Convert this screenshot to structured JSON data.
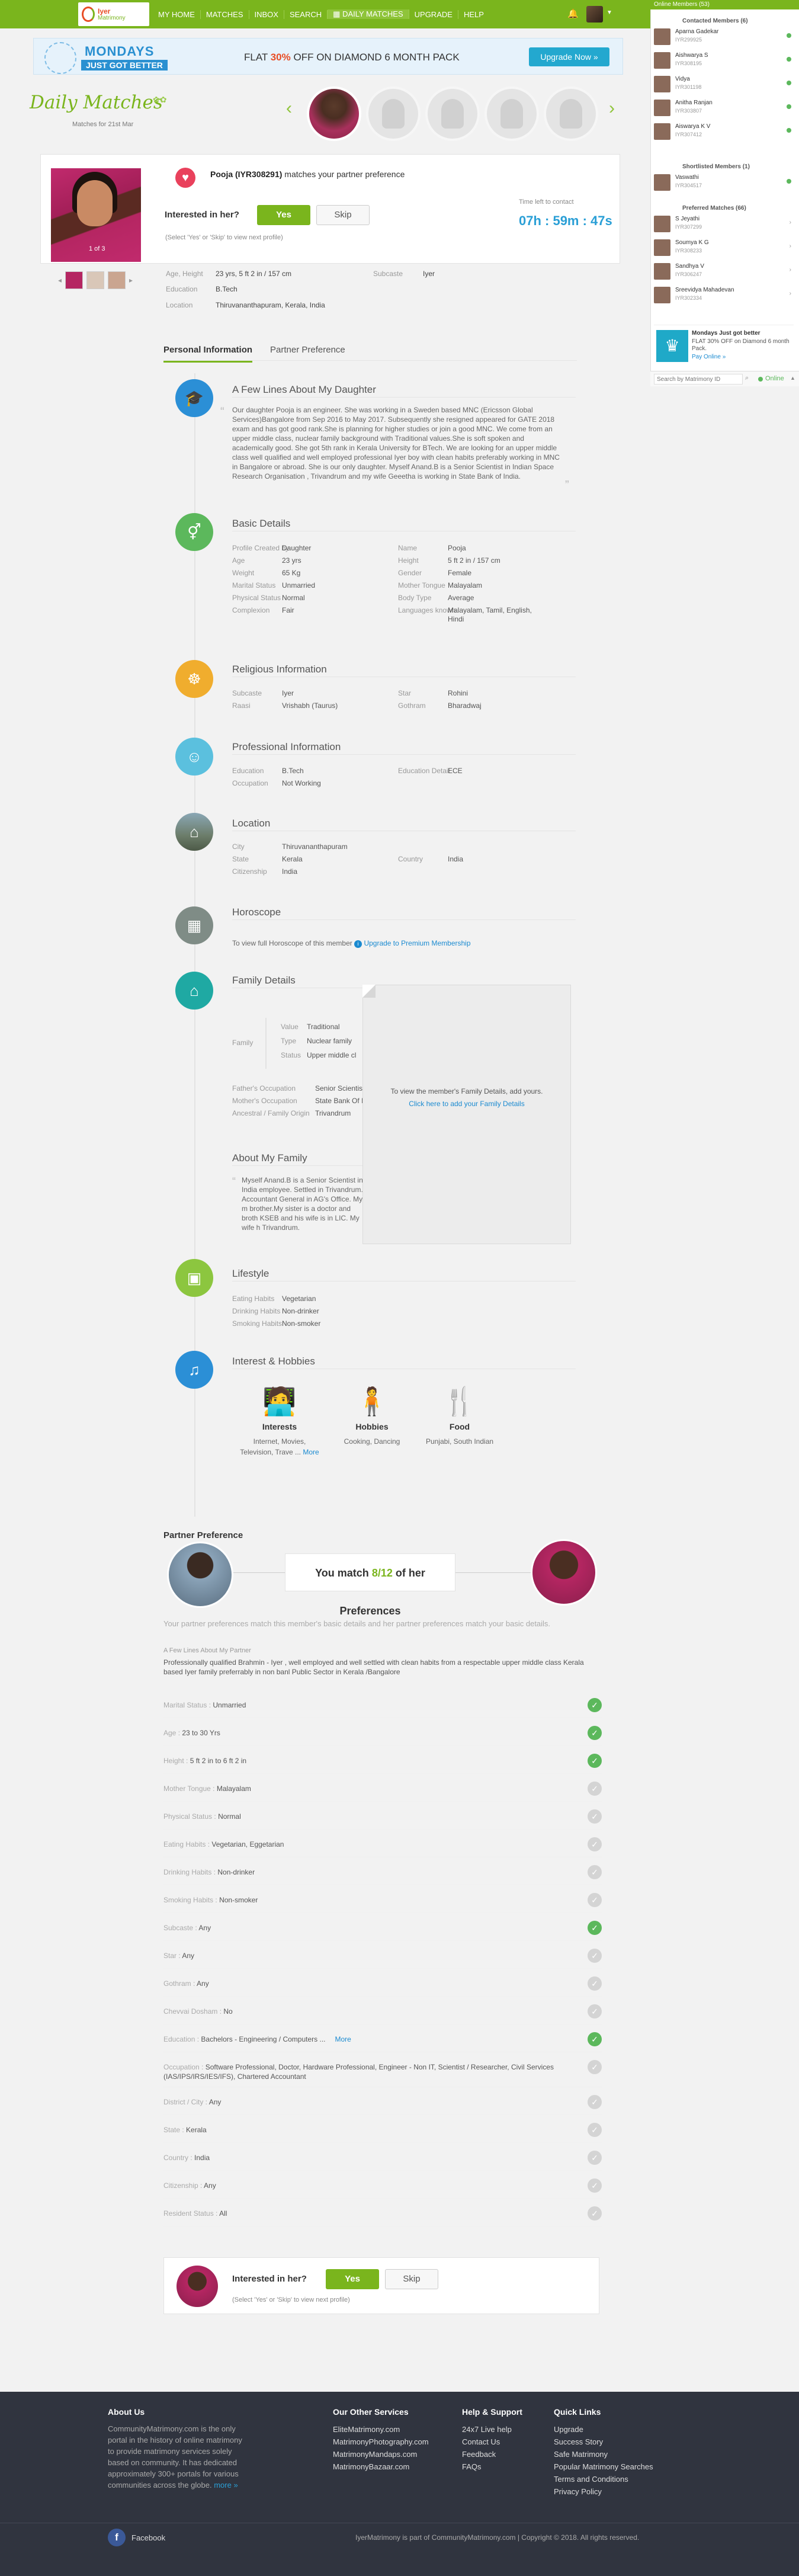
{
  "nav": {
    "logo_title": "Iyer",
    "logo_sub": "Matrimony",
    "items": [
      "MY HOME",
      "MATCHES",
      "INBOX",
      "SEARCH",
      "DAILY MATCHES",
      "UPGRADE",
      "HELP"
    ],
    "active_index": 4
  },
  "banner": {
    "line1": "MONDAYS",
    "line2": "JUST GOT BETTER",
    "offer_pre": "FLAT ",
    "offer_pct": "30%",
    "offer_post": " OFF ON DIAMOND 6 MONTH PACK",
    "button": "Upgrade Now »"
  },
  "daily": {
    "title": "Daily Matches",
    "subtitle": "Matches for 21st Mar"
  },
  "profile": {
    "id_name": "Pooja (IYR308291)",
    "id_suffix": " matches your partner preference",
    "photo_count": "1 of 3",
    "interested_q": "Interested in her?",
    "yes": "Yes",
    "skip": "Skip",
    "hint": "(Select 'Yes' or 'Skip' to view next profile)",
    "time_label": "Time left to contact",
    "time_value": "07h : 59m : 47s",
    "summary": [
      {
        "label": "Age, Height",
        "value": "23 yrs, 5 ft 2 in / 157 cm"
      },
      {
        "label": "Education",
        "value": "B.Tech"
      },
      {
        "label": "Location",
        "value": "Thiruvananthapuram, Kerala, India"
      }
    ],
    "subcaste_label": "Subcaste",
    "subcaste_value": "Iyer"
  },
  "tabs": [
    "Personal Information",
    "Partner Preference"
  ],
  "sections": {
    "about": {
      "title": "A Few Lines About My Daughter",
      "text": "Our daughter Pooja is an engineer. She was working in a Sweden based MNC (Ericsson Global Services)Bangalore from Sep 2016 to May 2017. Subsequently she resigned appeared for GATE 2018 exam and has got good rank.She is planning for higher studies or join a good MNC. We come from an upper middle class, nuclear family background with Traditional values.She is soft spoken and academically good. She got 5th rank in Kerala University for BTech. We are looking for an upper middle class well qualified and well employed professional Iyer boy with clean habits preferably working in MNC in Bangalore or abroad. She is our only daughter. Myself Anand.B is a Senior Scientist in Indian Space Research Organisation , Trivandrum and my wife Geeetha is working in State Bank of India."
    },
    "basic": {
      "title": "Basic Details",
      "left": [
        [
          "Profile Created by",
          "Daughter"
        ],
        [
          "Age",
          "23 yrs"
        ],
        [
          "Weight",
          "65 Kg"
        ],
        [
          "Marital Status",
          "Unmarried"
        ],
        [
          "Physical Status",
          "Normal"
        ],
        [
          "Complexion",
          "Fair"
        ]
      ],
      "right": [
        [
          "Name",
          "Pooja"
        ],
        [
          "Height",
          "5 ft 2 in / 157 cm"
        ],
        [
          "Gender",
          "Female"
        ],
        [
          "Mother Tongue",
          "Malayalam"
        ],
        [
          "Body Type",
          "Average"
        ],
        [
          "Languages known",
          "Malayalam, Tamil, English, Hindi"
        ]
      ]
    },
    "religious": {
      "title": "Religious Information",
      "left": [
        [
          "Subcaste",
          "Iyer"
        ],
        [
          "Raasi",
          "Vrishabh (Taurus)"
        ]
      ],
      "right": [
        [
          "Star",
          "Rohini"
        ],
        [
          "Gothram",
          "Bharadwaj"
        ]
      ]
    },
    "professional": {
      "title": "Professional Information",
      "left": [
        [
          "Education",
          "B.Tech"
        ],
        [
          "Occupation",
          "Not Working"
        ]
      ],
      "right": [
        [
          "Education Detail",
          "ECE"
        ]
      ]
    },
    "location": {
      "title": "Location",
      "left": [
        [
          "City",
          "Thiruvananthapuram"
        ],
        [
          "State",
          "Kerala"
        ],
        [
          "Citizenship",
          "India"
        ]
      ],
      "right": [
        [
          "Country",
          "India"
        ]
      ]
    },
    "horoscope": {
      "title": "Horoscope",
      "text": "To view full Horoscope of this member",
      "link": "Upgrade to Premium Membership"
    },
    "family": {
      "title": "Family Details",
      "family_label": "Family",
      "values": [
        [
          "Value",
          "Traditional"
        ],
        [
          "Type",
          "Nuclear family"
        ],
        [
          "Status",
          "Upper middle cl"
        ]
      ],
      "rows": [
        [
          "Father's Occupation",
          "Senior Scientist"
        ],
        [
          "Mother's Occupation",
          "State Bank Of I"
        ],
        [
          "Ancestral / Family Origin",
          "Trivandrum"
        ]
      ],
      "overlay_text": "To view the member's Family Details, add yours.",
      "overlay_link": "Click here to add your Family Details"
    },
    "about_family": {
      "title": "About My Family",
      "text": "Myself Anand.B is a Senior Scientist in India employee. Settled in Trivandrum. Accountant General in AG's Office. My m brother.My sister is a doctor and broth KSEB and his wife is in LIC. My wife h Trivandrum."
    },
    "lifestyle": {
      "title": "Lifestyle",
      "rows": [
        [
          "Eating Habits",
          "Vegetarian"
        ],
        [
          "Drinking Habits",
          "Non-drinker"
        ],
        [
          "Smoking Habits",
          "Non-smoker"
        ]
      ]
    },
    "interests": {
      "title": "Interest & Hobbies",
      "items": [
        {
          "title": "Interests",
          "text": "Internet, Movies, Television, Trave ...",
          "more": "More"
        },
        {
          "title": "Hobbies",
          "text": "Cooking, Dancing",
          "more": ""
        },
        {
          "title": "Food",
          "text": "Punjabi, South Indian",
          "more": ""
        }
      ]
    }
  },
  "partner": {
    "title": "Partner Preference",
    "match_pre": "You match ",
    "match_num": "8/12",
    "match_post": " of her Preferences",
    "note": "Your partner preferences match this member's basic details and her partner preferences match your basic details.",
    "few_lines_label": "A Few Lines About My Partner",
    "few_lines": "Professionally qualified Brahmin - Iyer , well employed and well settled with clean habits from a respectable upper middle class Kerala based Iyer family preferrably in non banl Public Sector in Kerala /Bangalore",
    "rows": [
      {
        "label": "Marital Status",
        "value": "Unmarried",
        "match": true
      },
      {
        "label": "Age",
        "value": "23 to 30 Yrs",
        "match": true
      },
      {
        "label": "Height",
        "value": "5 ft 2 in to 6 ft 2 in",
        "match": true
      },
      {
        "label": "Mother Tongue",
        "value": "Malayalam",
        "match": false
      },
      {
        "label": "Physical Status",
        "value": "Normal",
        "match": null
      },
      {
        "label": "Eating Habits",
        "value": "Vegetarian, Eggetarian",
        "match": false
      },
      {
        "label": "Drinking Habits",
        "value": "Non-drinker",
        "match": null
      },
      {
        "label": "Smoking Habits",
        "value": "Non-smoker",
        "match": null
      },
      {
        "label": "Subcaste",
        "value": "Any",
        "match": true
      },
      {
        "label": "Star",
        "value": "Any",
        "match": null
      },
      {
        "label": "Gothram",
        "value": "Any",
        "match": null
      },
      {
        "label": "Chevvai Dosham",
        "value": "No",
        "match": false
      },
      {
        "label": "Education",
        "value": "Bachelors - Engineering / Computers ...",
        "more": "More",
        "match": true
      },
      {
        "label": "Occupation",
        "value": "Software Professional, Doctor, Hardware Professional, Engineer - Non IT, Scientist / Researcher, Civil Services (IAS/IPS/IRS/IES/IFS), Chartered Accountant",
        "match": false
      },
      {
        "label": "District / City",
        "value": "Any",
        "match": false
      },
      {
        "label": "State",
        "value": "Kerala",
        "match": false
      },
      {
        "label": "Country",
        "value": "India",
        "match": false
      },
      {
        "label": "Citizenship",
        "value": "Any",
        "match": null
      },
      {
        "label": "Resident Status",
        "value": "All",
        "match": null
      }
    ]
  },
  "bottom": {
    "interested_q": "Interested in her?",
    "yes": "Yes",
    "skip": "Skip",
    "hint": "(Select 'Yes' or 'Skip' to view next profile)"
  },
  "footer": {
    "about_title": "About Us",
    "about_text": "CommunityMatrimony.com is the only portal in the history of online matrimony to provide matrimony services solely based on community. It has dedicated approximately 300+ portals for various communities across the globe.",
    "about_more": "more »",
    "services_title": "Our Other Services",
    "services": [
      "EliteMatrimony.com",
      "MatrimonyPhotography.com",
      "MatrimonyMandaps.com",
      "MatrimonyBazaar.com"
    ],
    "help_title": "Help & Support",
    "help": [
      "24x7 Live help",
      "Contact Us",
      "Feedback",
      "FAQs"
    ],
    "quick_title": "Quick Links",
    "quick": [
      "Upgrade",
      "Success Story",
      "Safe Matrimony",
      "Popular Matrimony Searches",
      "Terms and Conditions",
      "Privacy Policy"
    ],
    "facebook": "Facebook",
    "copyright": "IyerMatrimony is part of CommunityMatrimony.com | Copyright © 2018. All rights reserved."
  },
  "right_panel": {
    "header": "Online Members (53)",
    "contacted_title": "Contacted Members (6)",
    "contacted": [
      {
        "name": "Aparna Gadekar",
        "id": "IYR299925"
      },
      {
        "name": "Aishwarya S",
        "id": "IYR308195"
      },
      {
        "name": "Vidya",
        "id": "IYR301198"
      },
      {
        "name": "Anitha Ranjan",
        "id": "IYR303807"
      },
      {
        "name": "Aiswarya K V",
        "id": "IYR307412"
      }
    ],
    "shortlisted_title": "Shortlisted Members (1)",
    "shortlisted": [
      {
        "name": "Vaswathi",
        "id": "IYR304517"
      }
    ],
    "preferred_title": "Preferred Matches (66)",
    "preferred": [
      {
        "name": "S Jeyathi",
        "id": "IYR307299"
      },
      {
        "name": "Soumya K G",
        "id": "IYR308233"
      },
      {
        "name": "Sandhya V",
        "id": "IYR306247"
      },
      {
        "name": "Sreevidya Mahadevan",
        "id": "IYR302334"
      }
    ],
    "ad_title": "Mondays Just got better",
    "ad_text": "FLAT 30% OFF on Diamond 6 month Pack.",
    "ad_link": "Pay Online »",
    "search_placeholder": "Search by Matrimony ID",
    "online": "Online"
  }
}
